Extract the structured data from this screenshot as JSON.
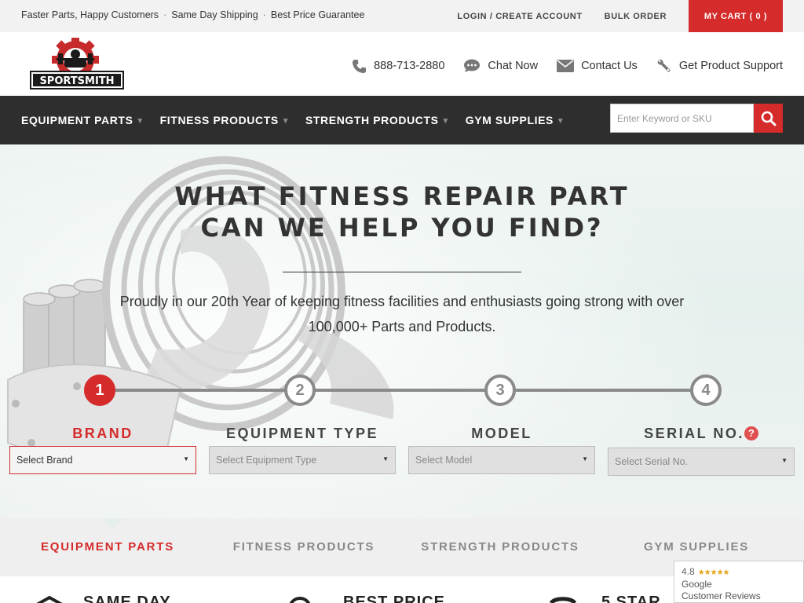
{
  "topbar": {
    "tagline": [
      "Faster Parts, Happy Customers",
      "Same Day Shipping",
      "Best Price Guarantee"
    ],
    "separator": "·",
    "login_label": "LOGIN / CREATE ACCOUNT",
    "bulk_order_label": "BULK ORDER",
    "cart_label": "MY CART ( 0 )"
  },
  "header": {
    "logo_text": "SPORTSMITH",
    "phone": "888-713-2880",
    "chat": "Chat Now",
    "contact": "Contact Us",
    "support": "Get Product Support"
  },
  "nav": {
    "items": [
      {
        "label": "EQUIPMENT PARTS",
        "caret": "▾"
      },
      {
        "label": "FITNESS PRODUCTS",
        "caret": "▾"
      },
      {
        "label": "STRENGTH PRODUCTS",
        "caret": "▾"
      },
      {
        "label": "GYM SUPPLIES",
        "caret": "▾"
      }
    ],
    "search_placeholder": "Enter Keyword or SKU"
  },
  "hero": {
    "title_line1": "WHAT FITNESS REPAIR PART",
    "title_line2": "CAN WE HELP YOU FIND?",
    "subtitle": "Proudly in our 20th Year of keeping fitness facilities and enthusiasts going strong with over 100,000+ Parts and Products.",
    "steps": [
      {
        "number": "1",
        "label": "BRAND",
        "select": "Select Brand"
      },
      {
        "number": "2",
        "label": "EQUIPMENT TYPE",
        "select": "Select Equipment Type"
      },
      {
        "number": "3",
        "label": "MODEL",
        "select": "Select Model"
      },
      {
        "number": "4",
        "label": "SERIAL NO.",
        "select": "Select Serial No."
      }
    ],
    "help_glyph": "?"
  },
  "categories": [
    "EQUIPMENT PARTS",
    "FITNESS PRODUCTS",
    "STRENGTH PRODUCTS",
    "GYM SUPPLIES"
  ],
  "features": [
    "SAME DAY",
    "BEST PRICE",
    "5 STAR"
  ],
  "google_badge": {
    "rating": "4.8",
    "stars": "★★★★★",
    "line1": "Google",
    "line2": "Customer Reviews"
  },
  "colors": {
    "accent": "#d52b2b",
    "nav_bg": "#2e2e2e",
    "topbar_bg": "#f2f2f2"
  }
}
